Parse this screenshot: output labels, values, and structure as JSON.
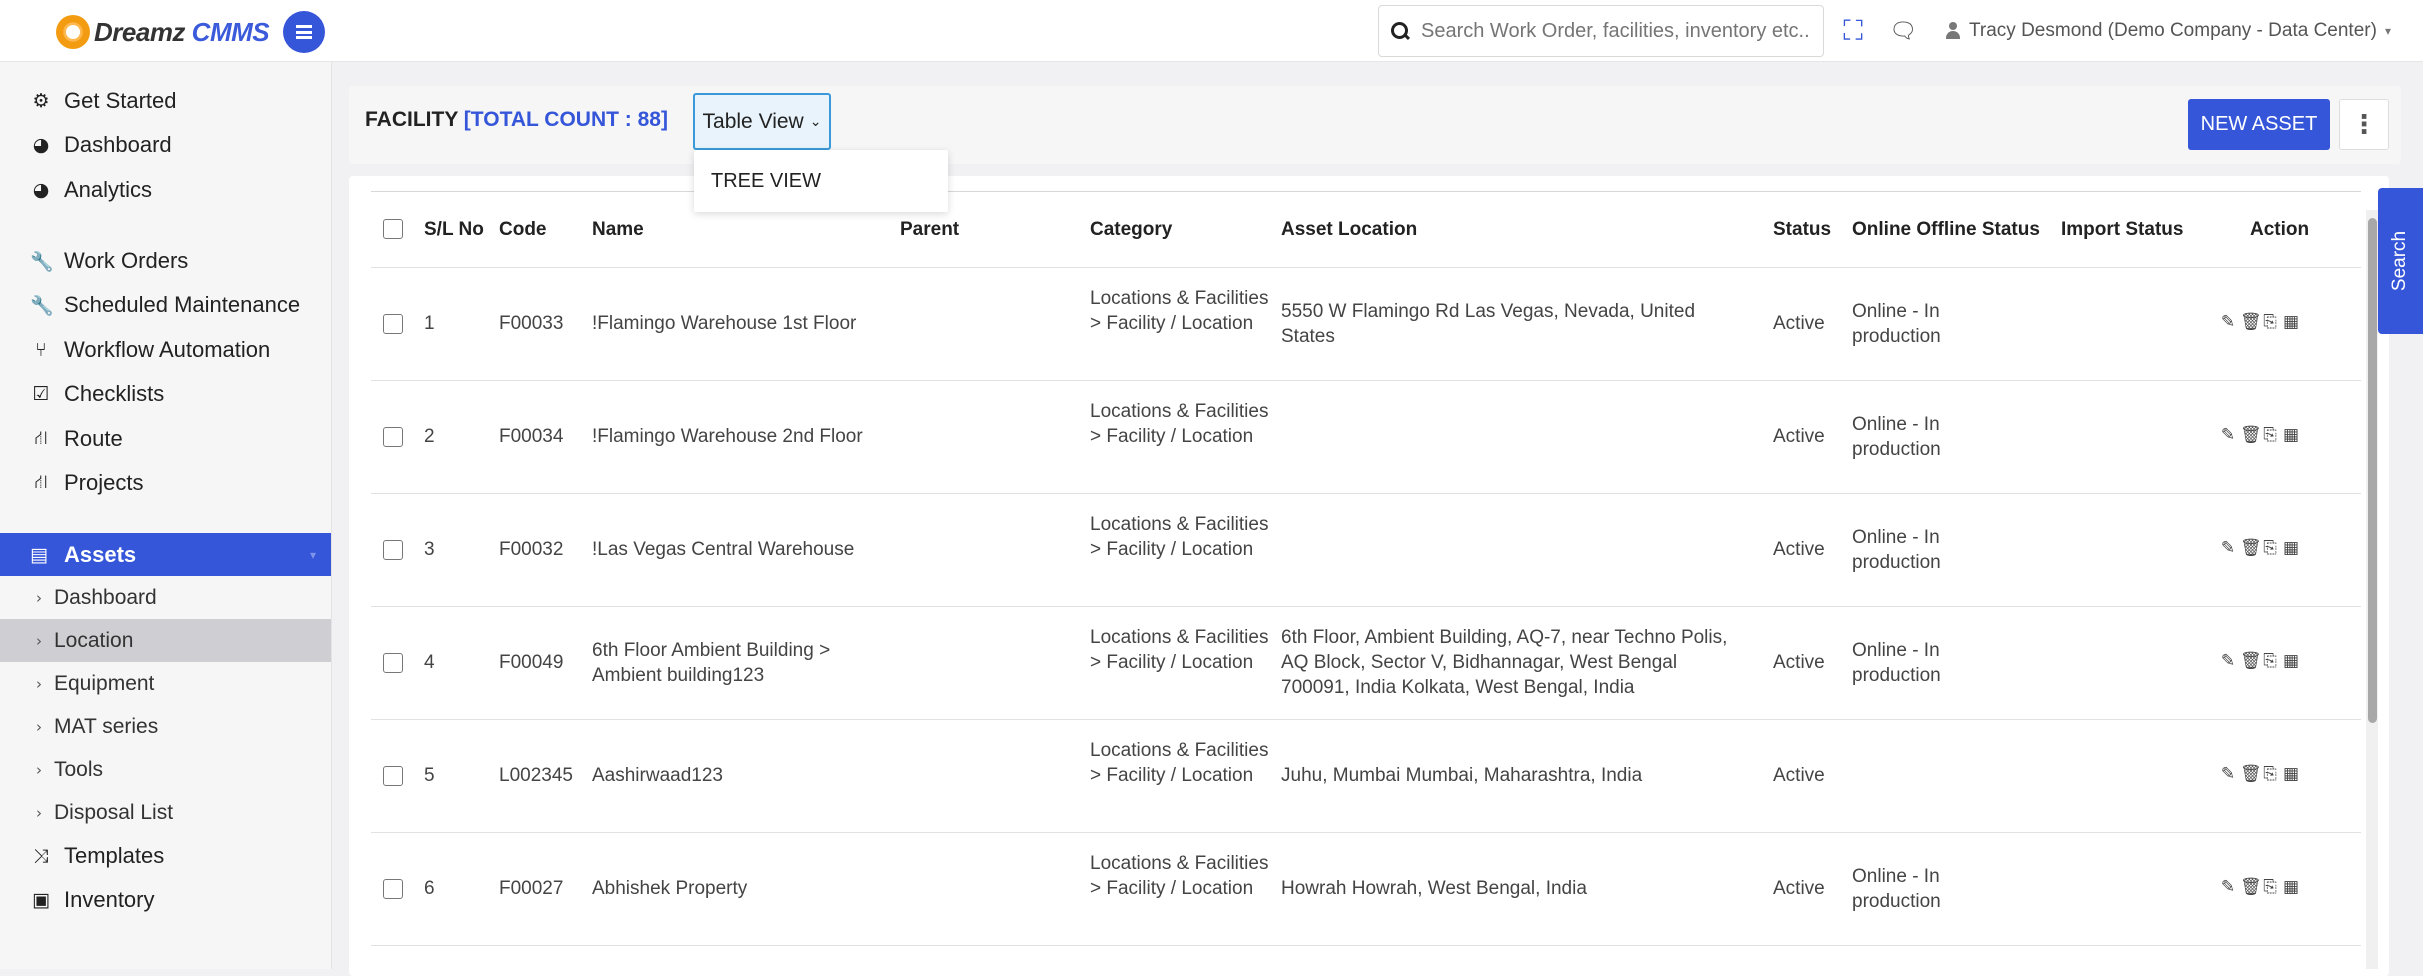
{
  "app": {
    "logo_prefix": "Dreamz",
    "logo_suffix": "CMMS",
    "search_placeholder": "Search Work Order, facilities, inventory etc...",
    "user_label": "Tracy Desmond (Demo Company - Data Center)"
  },
  "sidebar": {
    "items": [
      {
        "label": "Get Started",
        "icon": "gears-icon",
        "glyph": "⚙"
      },
      {
        "label": "Dashboard",
        "icon": "dashboard-icon",
        "glyph": "◕"
      },
      {
        "label": "Analytics",
        "icon": "analytics-icon",
        "glyph": "◕"
      },
      {
        "label": "Work Orders",
        "icon": "wrench-icon",
        "glyph": "🔧"
      },
      {
        "label": "Scheduled Maintenance",
        "icon": "wrench-icon",
        "glyph": "🔧"
      },
      {
        "label": "Workflow Automation",
        "icon": "workflow-icon",
        "glyph": "⑂"
      },
      {
        "label": "Checklists",
        "icon": "checkbox-icon",
        "glyph": "☑"
      },
      {
        "label": "Route",
        "icon": "road-icon",
        "glyph": "⛙"
      },
      {
        "label": "Projects",
        "icon": "road-icon",
        "glyph": "⛙"
      }
    ],
    "active": {
      "label": "Assets",
      "icon": "assets-icon"
    },
    "sub_items": [
      {
        "label": "Dashboard"
      },
      {
        "label": "Location",
        "selected": true
      },
      {
        "label": "Equipment"
      },
      {
        "label": "MAT series"
      },
      {
        "label": "Tools"
      },
      {
        "label": "Disposal List"
      }
    ],
    "bottom_items": [
      {
        "label": "Templates",
        "icon": "shuffle-icon",
        "glyph": "⤨"
      },
      {
        "label": "Inventory",
        "icon": "briefcase-icon",
        "glyph": "▣"
      }
    ]
  },
  "page": {
    "title": "FACILITY",
    "total_count": "[TOTAL COUNT : 88]",
    "view_select": "Table View",
    "dropdown_option": "TREE VIEW",
    "new_asset_label": "NEW ASSET",
    "side_search_label": "Search"
  },
  "table": {
    "columns": [
      "S/L No",
      "Code",
      "Name",
      "Parent",
      "Category",
      "Asset Location",
      "Status",
      "Online Offline Status",
      "Import Status",
      "Action"
    ],
    "rows": [
      {
        "sl": "1",
        "code": "F00033",
        "name": "!Flamingo Warehouse 1st Floor",
        "parent": "",
        "category": "Locations & Facilities > Facility / Location",
        "location": "5550 W Flamingo Rd Las Vegas, Nevada, United States",
        "status": "Active",
        "online": "Online - In production",
        "import": ""
      },
      {
        "sl": "2",
        "code": "F00034",
        "name": "!Flamingo Warehouse 2nd Floor",
        "parent": "",
        "category": "Locations & Facilities > Facility / Location",
        "location": "",
        "status": "Active",
        "online": "Online - In production",
        "import": ""
      },
      {
        "sl": "3",
        "code": "F00032",
        "name": "!Las Vegas Central Warehouse",
        "parent": "",
        "category": "Locations & Facilities > Facility / Location",
        "location": "",
        "status": "Active",
        "online": "Online - In production",
        "import": ""
      },
      {
        "sl": "4",
        "code": "F00049",
        "name": "6th Floor Ambient Building > Ambient building123",
        "parent": "",
        "category": "Locations & Facilities > Facility / Location",
        "location": "6th Floor, Ambient Building, AQ-7, near Techno Polis, AQ Block, Sector V, Bidhannagar, West Bengal 700091, India Kolkata, West Bengal, India",
        "status": "Active",
        "online": "Online - In production",
        "import": ""
      },
      {
        "sl": "5",
        "code": "L002345",
        "name": "Aashirwaad123",
        "parent": "",
        "category": "Locations & Facilities > Facility / Location",
        "location": "Juhu, Mumbai Mumbai, Maharashtra, India",
        "status": "Active",
        "online": "",
        "import": ""
      },
      {
        "sl": "6",
        "code": "F00027",
        "name": "Abhishek Property",
        "parent": "",
        "category": "Locations & Facilities > Facility / Location",
        "location": "Howrah Howrah, West Bengal, India",
        "status": "Active",
        "online": "Online - In production",
        "import": ""
      }
    ]
  }
}
